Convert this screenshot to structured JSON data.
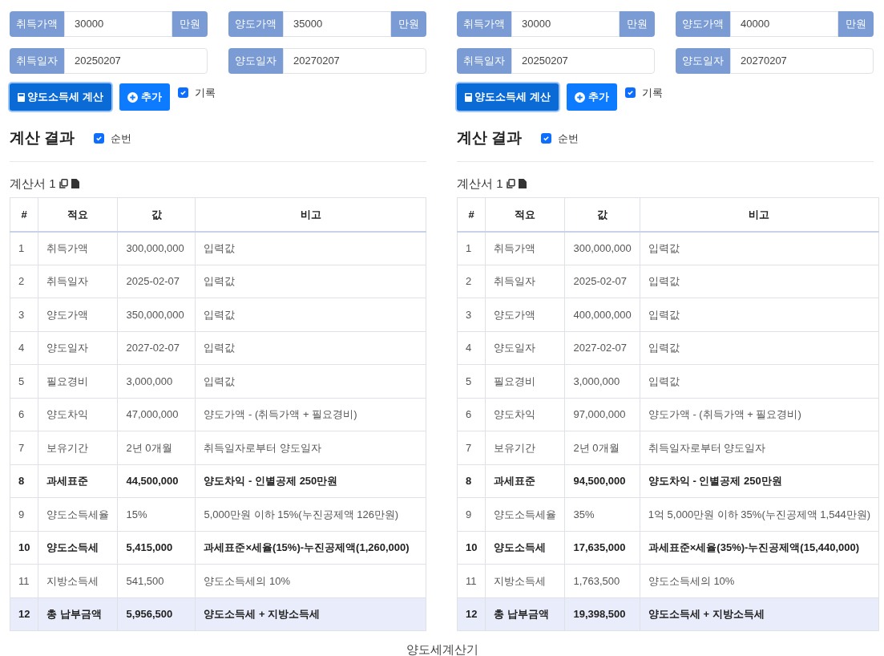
{
  "panels": [
    {
      "fields": [
        {
          "label": "취득가액",
          "value": "30000",
          "suffix": "만원"
        },
        {
          "label": "양도가액",
          "value": "35000",
          "suffix": "만원"
        },
        {
          "label": "취득일자",
          "value": "20250207"
        },
        {
          "label": "양도일자",
          "value": "20270207"
        }
      ],
      "calc_button": "양도소득세 계산",
      "add_button": "추가",
      "record": {
        "label": "기록",
        "checked": true
      },
      "heading": "계산 결과",
      "numbering": {
        "label": "순번",
        "checked": true
      },
      "doc_title": "계산서 1",
      "columns": [
        "#",
        "적요",
        "값",
        "비고"
      ],
      "rows": [
        {
          "kind": "normal",
          "cells": [
            "1",
            "취득가액",
            "300,000,000",
            "입력값"
          ]
        },
        {
          "kind": "normal",
          "cells": [
            "2",
            "취득일자",
            "2025-02-07",
            "입력값"
          ]
        },
        {
          "kind": "normal",
          "cells": [
            "3",
            "양도가액",
            "350,000,000",
            "입력값"
          ]
        },
        {
          "kind": "normal",
          "cells": [
            "4",
            "양도일자",
            "2027-02-07",
            "입력값"
          ]
        },
        {
          "kind": "normal",
          "cells": [
            "5",
            "필요경비",
            "3,000,000",
            "입력값"
          ]
        },
        {
          "kind": "normal",
          "cells": [
            "6",
            "양도차익",
            "47,000,000",
            "양도가액 - (취득가액 + 필요경비)"
          ]
        },
        {
          "kind": "normal",
          "cells": [
            "7",
            "보유기간",
            "2년 0개월",
            "취득일자로부터 양도일자"
          ]
        },
        {
          "kind": "bold",
          "cells": [
            "8",
            "과세표준",
            "44,500,000",
            "양도차익 - 인별공제 250만원"
          ]
        },
        {
          "kind": "normal",
          "cells": [
            "9",
            "양도소득세율",
            "15%",
            "5,000만원 이하 15%(누진공제액 126만원)"
          ]
        },
        {
          "kind": "bold",
          "cells": [
            "10",
            "양도소득세",
            "5,415,000",
            "과세표준×세율(15%)-누진공제액(1,260,000)"
          ]
        },
        {
          "kind": "normal",
          "cells": [
            "11",
            "지방소득세",
            "541,500",
            "양도소득세의 10%"
          ]
        },
        {
          "kind": "total",
          "cells": [
            "12",
            "총 납부금액",
            "5,956,500",
            "양도소득세 + 지방소득세"
          ]
        }
      ]
    },
    {
      "fields": [
        {
          "label": "취득가액",
          "value": "30000",
          "suffix": "만원"
        },
        {
          "label": "양도가액",
          "value": "40000",
          "suffix": "만원"
        },
        {
          "label": "취득일자",
          "value": "20250207"
        },
        {
          "label": "양도일자",
          "value": "20270207"
        }
      ],
      "calc_button": "양도소득세 계산",
      "add_button": "추가",
      "record": {
        "label": "기록",
        "checked": true
      },
      "heading": "계산 결과",
      "numbering": {
        "label": "순번",
        "checked": true
      },
      "doc_title": "계산서 1",
      "columns": [
        "#",
        "적요",
        "값",
        "비고"
      ],
      "rows": [
        {
          "kind": "normal",
          "cells": [
            "1",
            "취득가액",
            "300,000,000",
            "입력값"
          ]
        },
        {
          "kind": "normal",
          "cells": [
            "2",
            "취득일자",
            "2025-02-07",
            "입력값"
          ]
        },
        {
          "kind": "normal",
          "cells": [
            "3",
            "양도가액",
            "400,000,000",
            "입력값"
          ]
        },
        {
          "kind": "normal",
          "cells": [
            "4",
            "양도일자",
            "2027-02-07",
            "입력값"
          ]
        },
        {
          "kind": "normal",
          "cells": [
            "5",
            "필요경비",
            "3,000,000",
            "입력값"
          ]
        },
        {
          "kind": "normal",
          "cells": [
            "6",
            "양도차익",
            "97,000,000",
            "양도가액 - (취득가액 + 필요경비)"
          ]
        },
        {
          "kind": "normal",
          "cells": [
            "7",
            "보유기간",
            "2년 0개월",
            "취득일자로부터 양도일자"
          ]
        },
        {
          "kind": "bold",
          "cells": [
            "8",
            "과세표준",
            "94,500,000",
            "양도차익 - 인별공제 250만원"
          ]
        },
        {
          "kind": "normal",
          "cells": [
            "9",
            "양도소득세율",
            "35%",
            "1억 5,000만원 이하 35%(누진공제액 1,544만원)"
          ]
        },
        {
          "kind": "bold",
          "cells": [
            "10",
            "양도소득세",
            "17,635,000",
            "과세표준×세율(35%)-누진공제액(15,440,000)"
          ]
        },
        {
          "kind": "normal",
          "cells": [
            "11",
            "지방소득세",
            "1,763,500",
            "양도소득세의 10%"
          ]
        },
        {
          "kind": "total",
          "cells": [
            "12",
            "총 납부금액",
            "19,398,500",
            "양도소득세 + 지방소득세"
          ]
        }
      ]
    }
  ],
  "caption": "양도세계산기"
}
